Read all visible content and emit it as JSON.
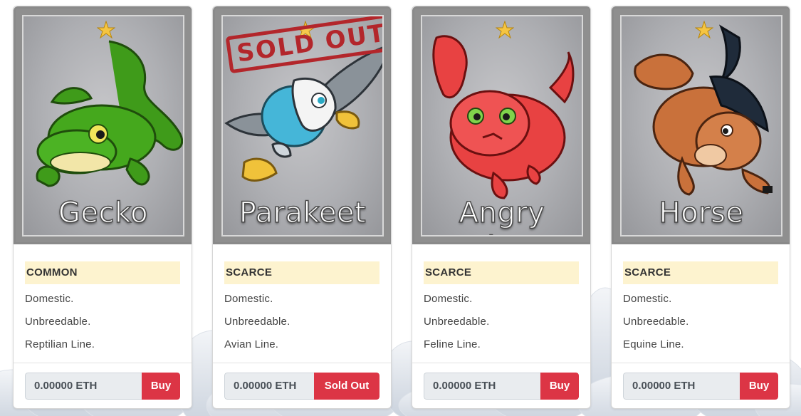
{
  "cards": [
    {
      "name": "Gecko",
      "rarity": "COMMON",
      "traits": [
        "Domestic.",
        "Unbreedable.",
        "Reptilian Line."
      ],
      "price": "0.00000 ETH",
      "button": "Buy",
      "sold_out": false,
      "creature_icon": "gecko-creature-icon",
      "colors": {
        "primary": "#3f9b1a",
        "accent": "#f2e6a8"
      }
    },
    {
      "name": "Parakeet",
      "rarity": "SCARCE",
      "traits": [
        "Domestic.",
        "Unbreedable.",
        "Avian Line."
      ],
      "price": "0.00000 ETH",
      "button": "Sold Out",
      "sold_out": true,
      "stamp": "SOLD OUT",
      "creature_icon": "parakeet-creature-icon",
      "colors": {
        "primary": "#45b6d8",
        "accent": "#f0c23a"
      }
    },
    {
      "name": "Angry Kitty",
      "rarity": "SCARCE",
      "traits": [
        "Domestic.",
        "Unbreedable.",
        "Feline Line."
      ],
      "price": "0.00000 ETH",
      "button": "Buy",
      "sold_out": false,
      "creature_icon": "angry-kitty-creature-icon",
      "colors": {
        "primary": "#e84242",
        "accent": "#7fd44b"
      }
    },
    {
      "name": "Horse",
      "rarity": "SCARCE",
      "traits": [
        "Domestic.",
        "Unbreedable.",
        "Equine Line."
      ],
      "price": "0.00000 ETH",
      "button": "Buy",
      "sold_out": false,
      "creature_icon": "horse-creature-icon",
      "colors": {
        "primary": "#c9713b",
        "accent": "#1f2b3a"
      }
    }
  ],
  "theme": {
    "rarity_bg": "#fdf3cf",
    "buy_button": "#dc3545",
    "price_bg": "#e9ecef",
    "star_icon": "gold-star-icon",
    "background_decoration": "clouds"
  }
}
